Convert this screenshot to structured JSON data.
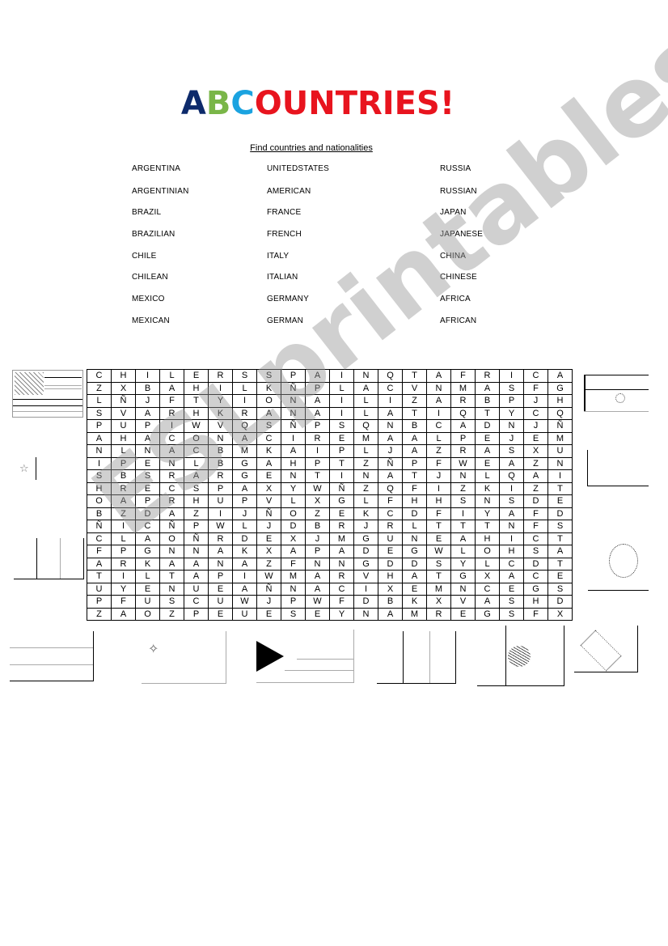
{
  "header": {
    "title_parts": [
      {
        "text": "A",
        "color": "#0d2a6b"
      },
      {
        "text": "B",
        "color": "#7ab648"
      },
      {
        "text": "C",
        "color": "#1ba3e0"
      },
      {
        "text": "OUNTRIES!",
        "color": "#e8141e"
      }
    ],
    "subtitle": "Find countries and nationalities"
  },
  "word_list": {
    "column1": [
      "ARGENTINA",
      "ARGENTINIAN",
      "BRAZIL",
      "BRAZILIAN",
      "CHILE",
      "CHILEAN",
      "MEXICO",
      "MEXICAN"
    ],
    "column2": [
      "UNITEDSTATES",
      "AMERICAN",
      "FRANCE",
      "FRENCH",
      "ITALY",
      "ITALIAN",
      "GERMANY",
      "GERMAN"
    ],
    "column3": [
      "RUSSIA",
      "RUSSIAN",
      "JAPAN",
      "JAPANESE",
      "CHINA",
      "CHINESE",
      "AFRICA",
      "AFRICAN"
    ]
  },
  "grid": {
    "rows": [
      [
        "C",
        "H",
        "I",
        "L",
        "E",
        "R",
        "S",
        "S",
        "P",
        "A",
        "I",
        "N",
        "Q",
        "T",
        "A",
        "F",
        "R",
        "I",
        "C",
        "A"
      ],
      [
        "Z",
        "X",
        "B",
        "A",
        "H",
        "I",
        "L",
        "K",
        "Ñ",
        "P",
        "L",
        "A",
        "C",
        "V",
        "N",
        "M",
        "A",
        "S",
        "F",
        "G"
      ],
      [
        "L",
        "Ñ",
        "J",
        "F",
        "T",
        "Y",
        "I",
        "O",
        "N",
        "A",
        "I",
        "L",
        "I",
        "Z",
        "A",
        "R",
        "B",
        "P",
        "J",
        "H"
      ],
      [
        "S",
        "V",
        "A",
        "R",
        "H",
        "K",
        "R",
        "A",
        "N",
        "A",
        "I",
        "L",
        "A",
        "T",
        "I",
        "Q",
        "T",
        "Y",
        "C",
        "Q"
      ],
      [
        "P",
        "U",
        "P",
        "I",
        "W",
        "V",
        "Q",
        "S",
        "Ñ",
        "P",
        "S",
        "Q",
        "N",
        "B",
        "C",
        "A",
        "D",
        "N",
        "J",
        "Ñ"
      ],
      [
        "A",
        "H",
        "A",
        "C",
        "O",
        "N",
        "A",
        "C",
        "I",
        "R",
        "E",
        "M",
        "A",
        "A",
        "L",
        "P",
        "E",
        "J",
        "E",
        "M"
      ],
      [
        "N",
        "L",
        "N",
        "A",
        "C",
        "B",
        "M",
        "K",
        "A",
        "I",
        "P",
        "L",
        "J",
        "A",
        "Z",
        "R",
        "A",
        "S",
        "X",
        "U"
      ],
      [
        "I",
        "P",
        "E",
        "N",
        "L",
        "B",
        "G",
        "A",
        "H",
        "P",
        "T",
        "Z",
        "Ñ",
        "P",
        "F",
        "W",
        "E",
        "A",
        "Z",
        "N"
      ],
      [
        "S",
        "B",
        "S",
        "R",
        "A",
        "R",
        "G",
        "E",
        "N",
        "T",
        "I",
        "N",
        "A",
        "T",
        "J",
        "N",
        "L",
        "Q",
        "A",
        "I"
      ],
      [
        "H",
        "R",
        "E",
        "C",
        "S",
        "P",
        "A",
        "X",
        "Y",
        "W",
        "Ñ",
        "Z",
        "Q",
        "F",
        "I",
        "Z",
        "K",
        "I",
        "Z",
        "T"
      ],
      [
        "O",
        "A",
        "P",
        "R",
        "H",
        "U",
        "P",
        "V",
        "L",
        "X",
        "G",
        "L",
        "F",
        "H",
        "H",
        "S",
        "N",
        "S",
        "D",
        "E"
      ],
      [
        "B",
        "Z",
        "D",
        "A",
        "Z",
        "I",
        "J",
        "Ñ",
        "O",
        "Z",
        "E",
        "K",
        "C",
        "D",
        "F",
        "I",
        "Y",
        "A",
        "F",
        "D"
      ],
      [
        "Ñ",
        "I",
        "C",
        "Ñ",
        "P",
        "W",
        "L",
        "J",
        "D",
        "B",
        "R",
        "J",
        "R",
        "L",
        "T",
        "T",
        "T",
        "N",
        "F",
        "S"
      ],
      [
        "C",
        "L",
        "A",
        "O",
        "Ñ",
        "R",
        "D",
        "E",
        "X",
        "J",
        "M",
        "G",
        "U",
        "N",
        "E",
        "A",
        "H",
        "I",
        "C",
        "T"
      ],
      [
        "F",
        "P",
        "G",
        "N",
        "N",
        "A",
        "K",
        "X",
        "A",
        "P",
        "A",
        "D",
        "E",
        "G",
        "W",
        "L",
        "O",
        "H",
        "S",
        "A"
      ],
      [
        "A",
        "R",
        "K",
        "A",
        "A",
        "N",
        "A",
        "Z",
        "F",
        "N",
        "N",
        "G",
        "D",
        "D",
        "S",
        "Y",
        "L",
        "C",
        "D",
        "T"
      ],
      [
        "T",
        "I",
        "L",
        "T",
        "A",
        "P",
        "I",
        "W",
        "M",
        "A",
        "R",
        "V",
        "H",
        "A",
        "T",
        "G",
        "X",
        "A",
        "C",
        "E"
      ],
      [
        "U",
        "Y",
        "E",
        "N",
        "U",
        "E",
        "A",
        "Ñ",
        "N",
        "A",
        "C",
        "I",
        "X",
        "E",
        "M",
        "N",
        "C",
        "E",
        "G",
        "S"
      ],
      [
        "P",
        "F",
        "U",
        "S",
        "C",
        "U",
        "W",
        "J",
        "P",
        "W",
        "F",
        "D",
        "B",
        "K",
        "X",
        "V",
        "A",
        "S",
        "H",
        "D"
      ],
      [
        "Z",
        "A",
        "O",
        "Z",
        "P",
        "E",
        "U",
        "E",
        "S",
        "E",
        "Y",
        "N",
        "A",
        "M",
        "R",
        "E",
        "G",
        "S",
        "F",
        "X"
      ]
    ]
  },
  "flags": [
    {
      "name": "united-states-flag"
    },
    {
      "name": "china-flag"
    },
    {
      "name": "italy-flag"
    },
    {
      "name": "argentina-flag"
    },
    {
      "name": "germany-flag"
    },
    {
      "name": "japan-flag"
    },
    {
      "name": "russia-flag"
    },
    {
      "name": "chile-flag"
    },
    {
      "name": "south-africa-flag"
    },
    {
      "name": "france-flag"
    },
    {
      "name": "mexico-flag"
    },
    {
      "name": "brazil-flag"
    }
  ],
  "watermark": "ESLprintables.com"
}
